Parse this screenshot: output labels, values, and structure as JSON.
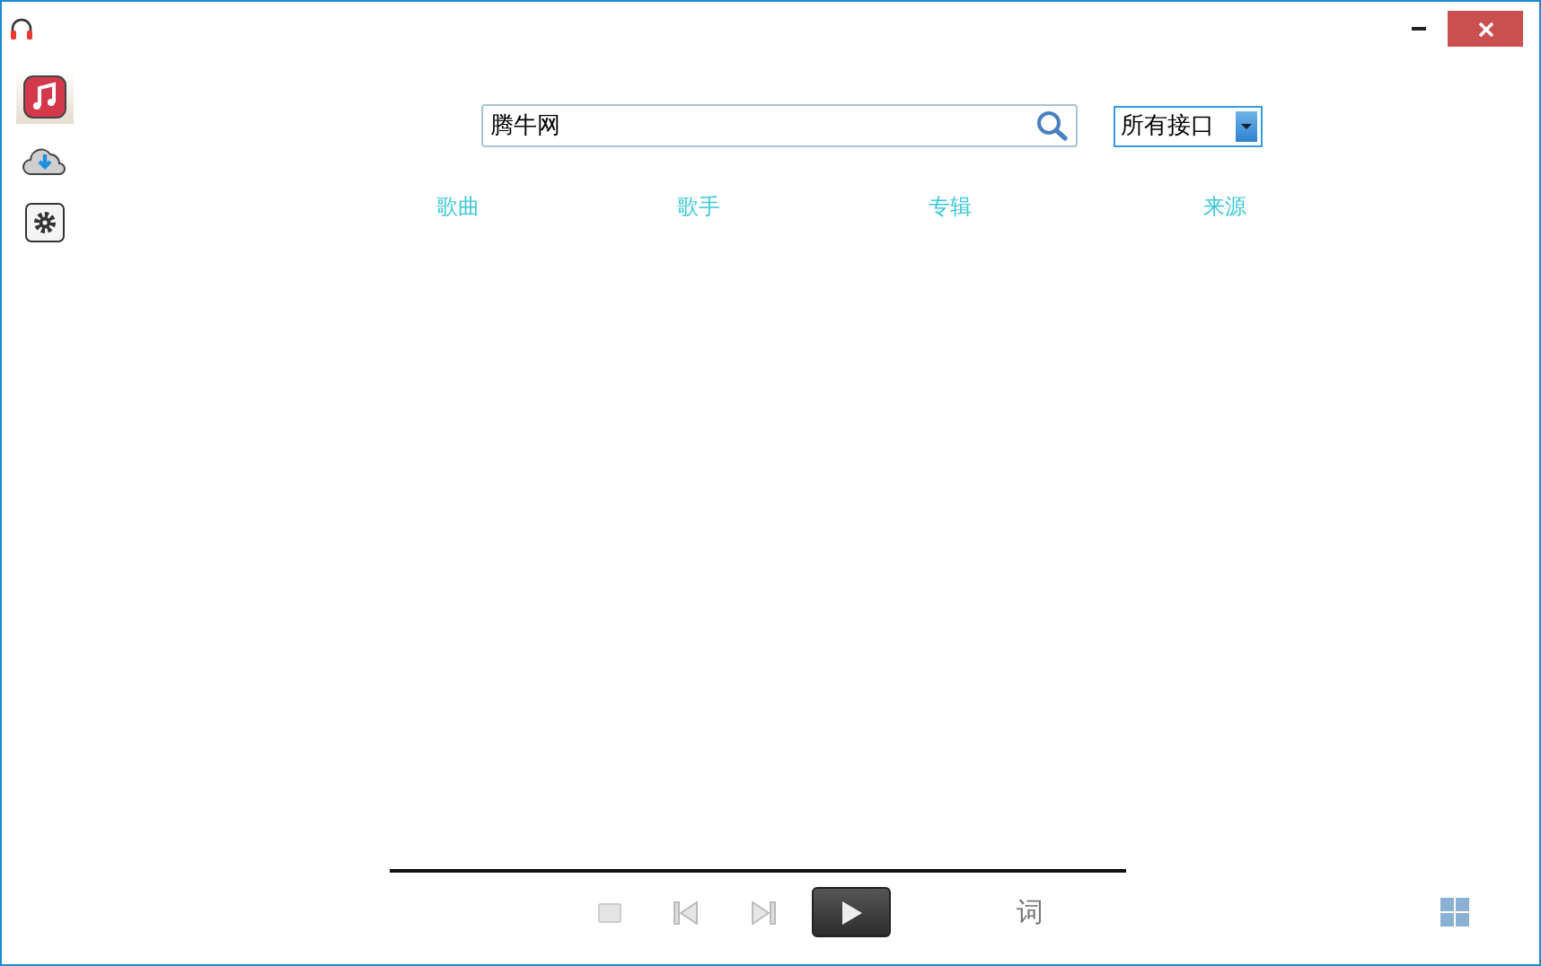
{
  "sidebar": {
    "items": [
      {
        "kind": "music",
        "selected": true
      },
      {
        "kind": "download",
        "selected": false
      },
      {
        "kind": "settings",
        "selected": false
      }
    ]
  },
  "search": {
    "value": "腾牛网"
  },
  "source_select": {
    "value": "所有接口"
  },
  "table": {
    "columns": [
      "歌曲",
      "歌手",
      "专辑",
      "来源"
    ]
  },
  "player": {
    "lyrics_button": "词"
  }
}
